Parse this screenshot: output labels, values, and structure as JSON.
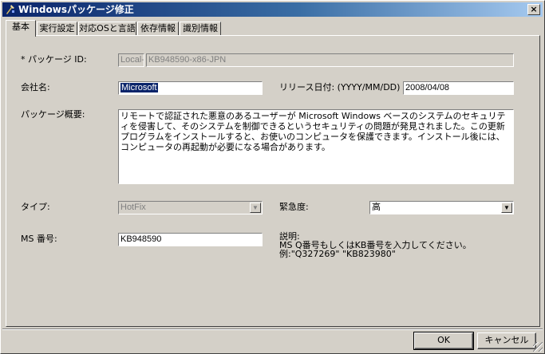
{
  "window": {
    "title": "Windowsパッケージ修正",
    "close_label": "×"
  },
  "tabs": [
    {
      "label": "基本"
    },
    {
      "label": "実行設定"
    },
    {
      "label": "対応OSと言語"
    },
    {
      "label": "依存情報"
    },
    {
      "label": "識別情報"
    }
  ],
  "form": {
    "package_id_label": "* パッケージ ID:",
    "package_id_prefix": "Local-",
    "package_id_value": "KB948590-x86-JPN",
    "company_label": "会社名:",
    "company_value": "Microsoft",
    "release_date_label": "リリース日付: (YYYY/MM/DD)",
    "release_date_value": "2008/04/08",
    "summary_label": "パッケージ概要:",
    "summary_value": "リモートで認証された悪意のあるユーザーが Microsoft Windows ベースのシステムのセキュリティを侵害して、そのシステムを制御できるというセキュリティの問題が発見されました。この更新プログラムをインストールすると、お使いのコンピュータを保護できます。インストール後には、コンピュータの再起動が必要になる場合があります。",
    "type_label": "タイプ:",
    "type_value": "HotFix",
    "urgency_label": "緊急度:",
    "urgency_value": "高",
    "ms_number_label": "MS 番号:",
    "ms_number_value": "KB948590",
    "description_title": "説明:",
    "description_line1": "MS Q番号もしくはKB番号を入力してください。",
    "description_line2": "例:\"Q327269\" \"KB823980\""
  },
  "buttons": {
    "ok": "OK",
    "cancel": "キャンセル"
  }
}
